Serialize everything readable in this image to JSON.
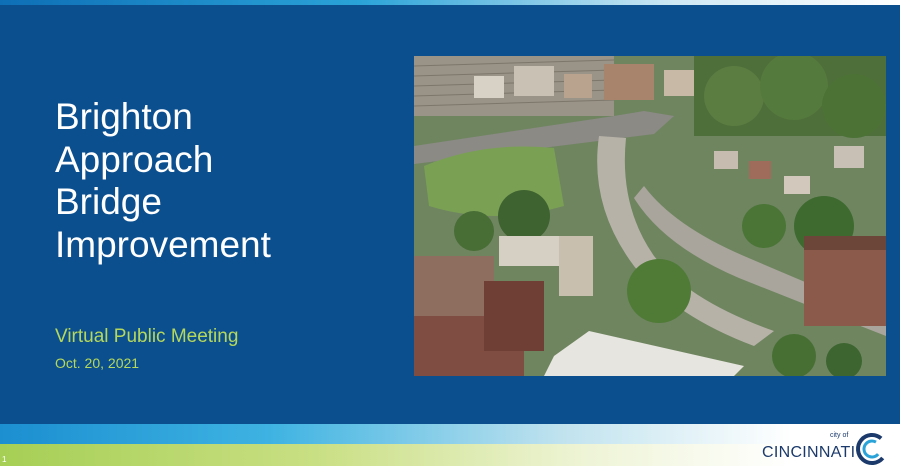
{
  "slide": {
    "title_lines": [
      "Brighton",
      "Approach",
      "Bridge",
      "Improvement"
    ],
    "subtitle": "Virtual Public Meeting",
    "date": "Oct. 20, 2021",
    "page_number": "1",
    "photo": {
      "description_icon": "aerial-photo"
    }
  },
  "logo": {
    "prefix": "city of",
    "name": "CINCINNATI",
    "icon": "cincinnati-c-logo"
  },
  "colors": {
    "panel": "#0b4f8f",
    "title": "#ffffff",
    "subtitle": "#b6d85a",
    "band_blue": "#1b8fd0",
    "band_green": "#a6cf55",
    "logo_navy": "#1b3a6b"
  }
}
